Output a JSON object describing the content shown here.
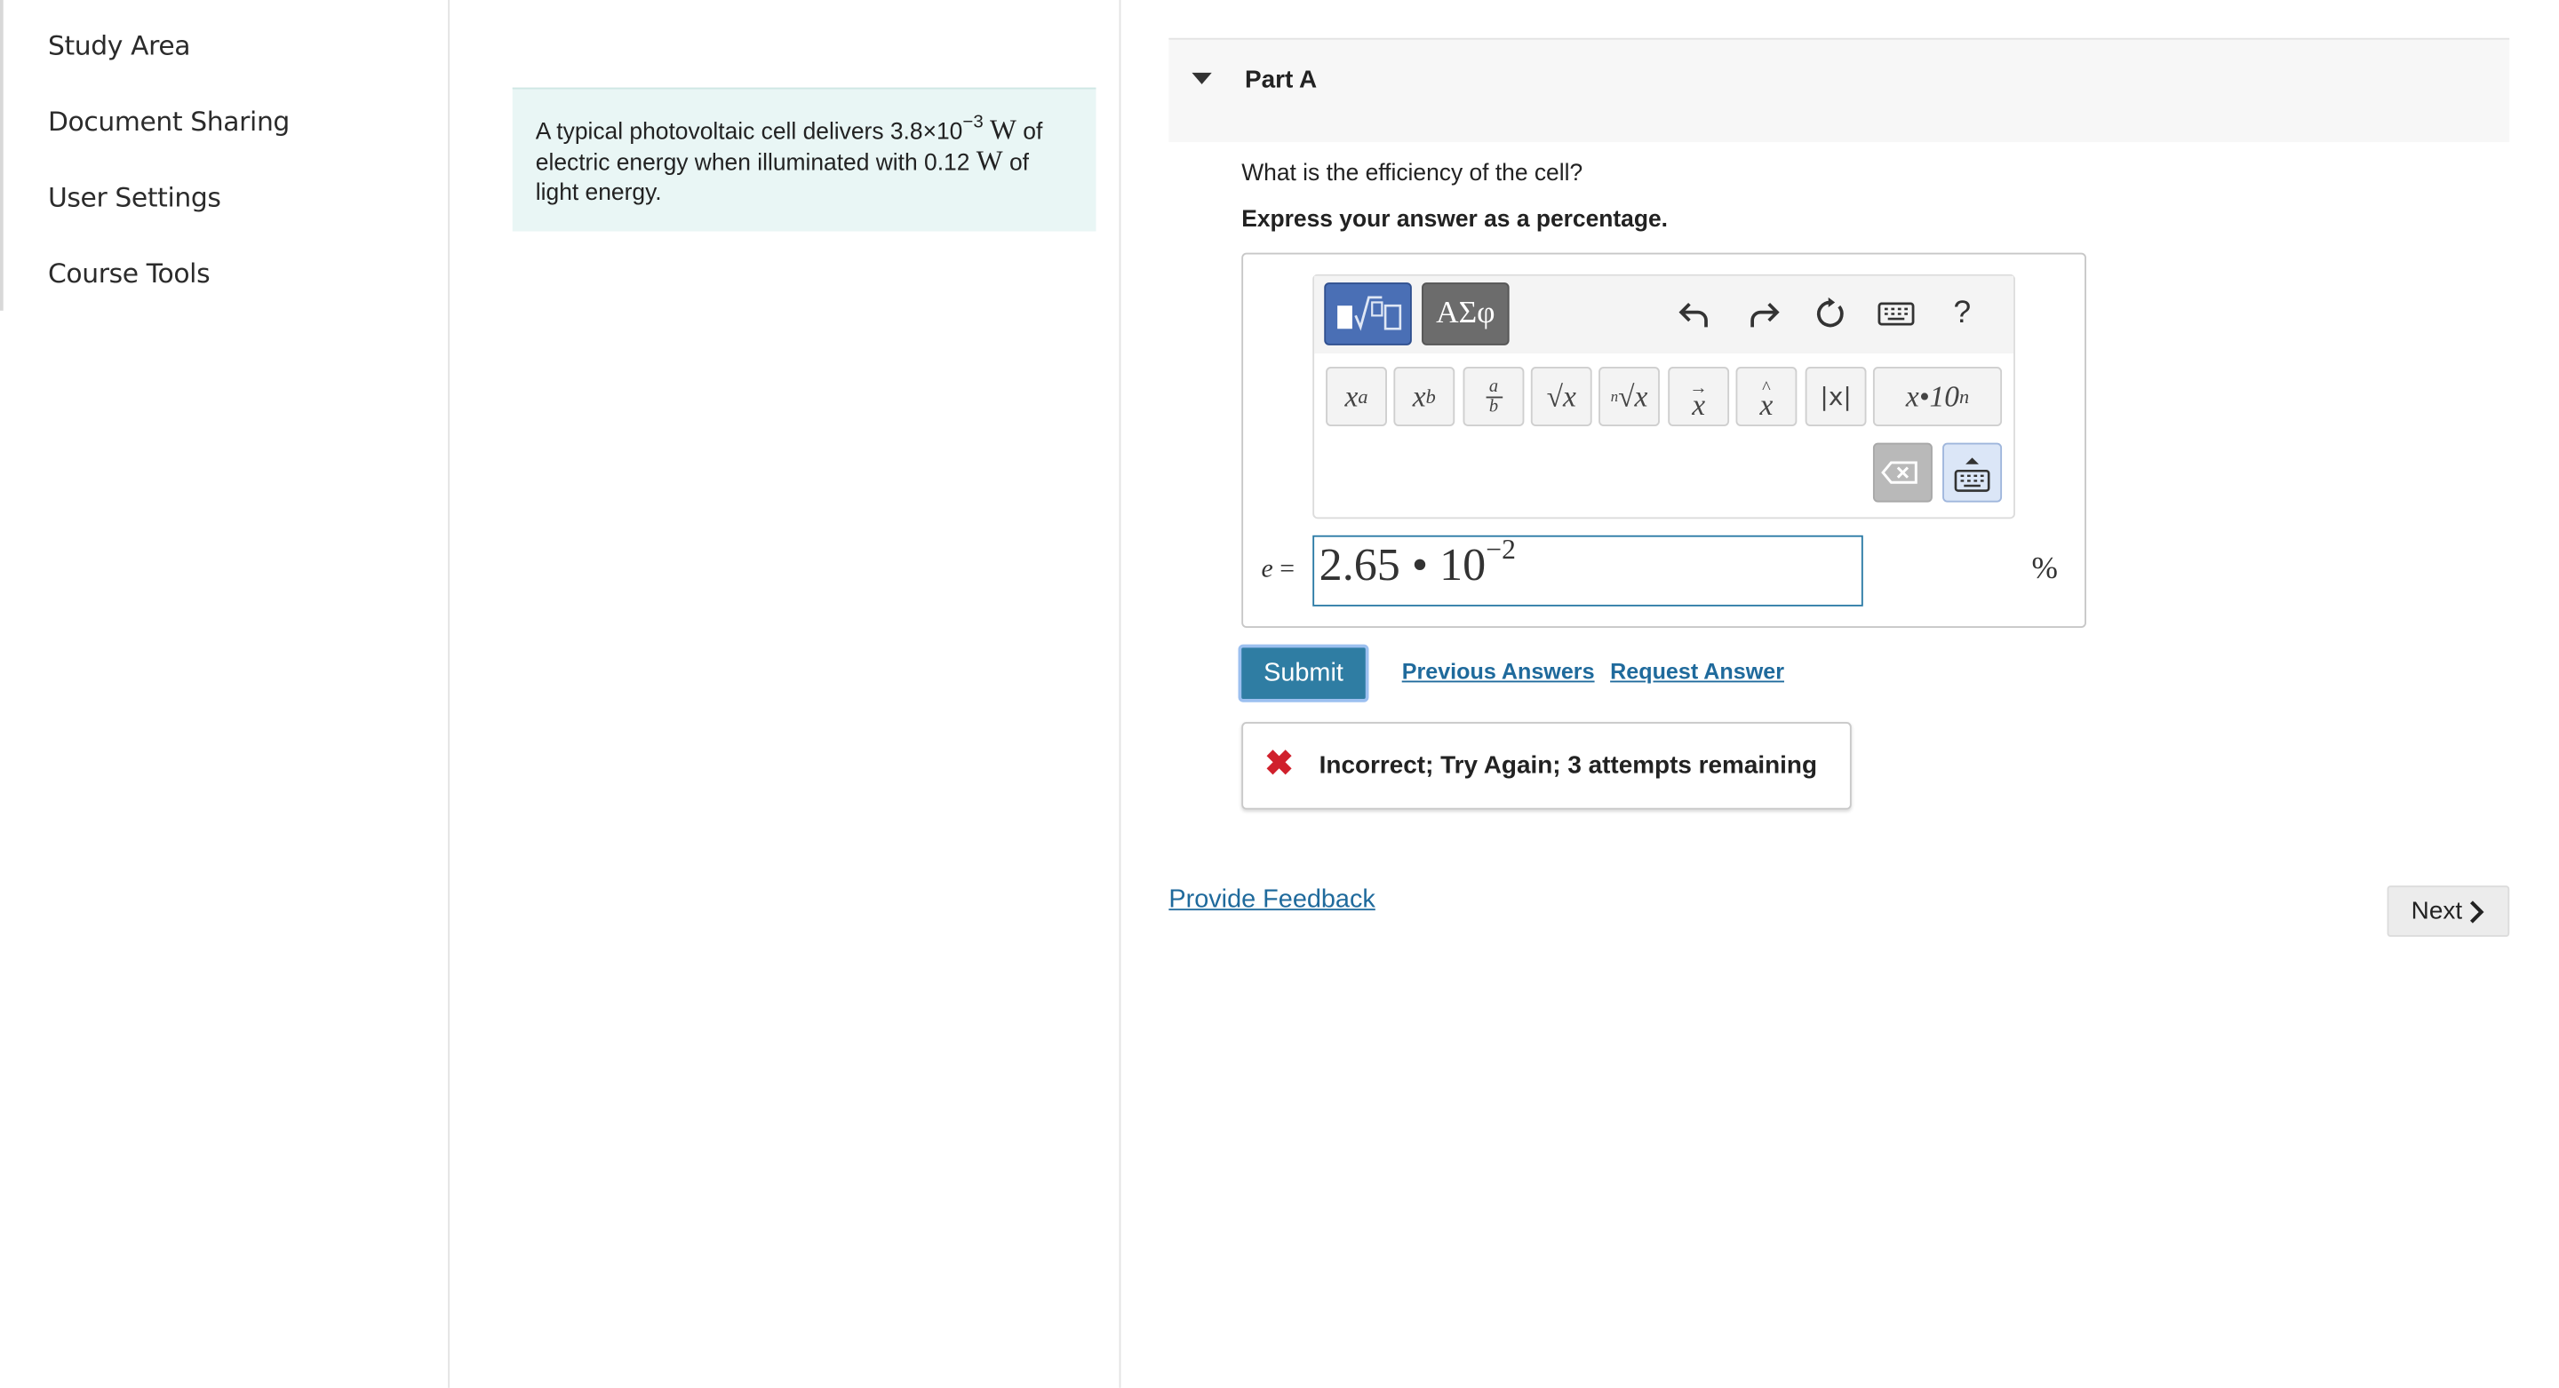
{
  "sidebar": {
    "items": [
      {
        "label": "Study Area"
      },
      {
        "label": "Document Sharing"
      },
      {
        "label": "User Settings"
      },
      {
        "label": "Course Tools"
      }
    ]
  },
  "problem": {
    "text_before": "A typical photovoltaic cell delivers 3.8×10",
    "exponent": "−3",
    "unit_w": "W",
    "text_mid": "of electric energy when illuminated with 0.12",
    "unit_w2": "W",
    "text_after": "of light energy."
  },
  "part": {
    "title": "Part A",
    "question": "What is the efficiency of the cell?",
    "instruction": "Express your answer as a percentage."
  },
  "toolbar": {
    "greek_label": "ΑΣφ",
    "help_label": "?",
    "symbols": {
      "power_base": "x",
      "power_exp": "a",
      "sub_base": "x",
      "sub_sub": "b",
      "frac_num": "a",
      "frac_den": "b",
      "sqrt": "√x",
      "nthroot_index": "n",
      "nthroot": "√x",
      "vector": "x",
      "hat": "x",
      "abs": "|x|",
      "sci": "x•10",
      "sci_exp": "n"
    }
  },
  "answer": {
    "variable": "e",
    "equals": "=",
    "value_mantissa": "2.65 • 10",
    "value_exponent": "−2",
    "unit": "%"
  },
  "actions": {
    "submit_label": "Submit",
    "previous_answers_label": "Previous Answers",
    "request_answer_label": "Request Answer"
  },
  "feedback": {
    "icon": "x-mark",
    "message": "Incorrect; Try Again; 3 attempts remaining"
  },
  "footer": {
    "provide_feedback_label": "Provide Feedback",
    "next_label": "Next"
  }
}
